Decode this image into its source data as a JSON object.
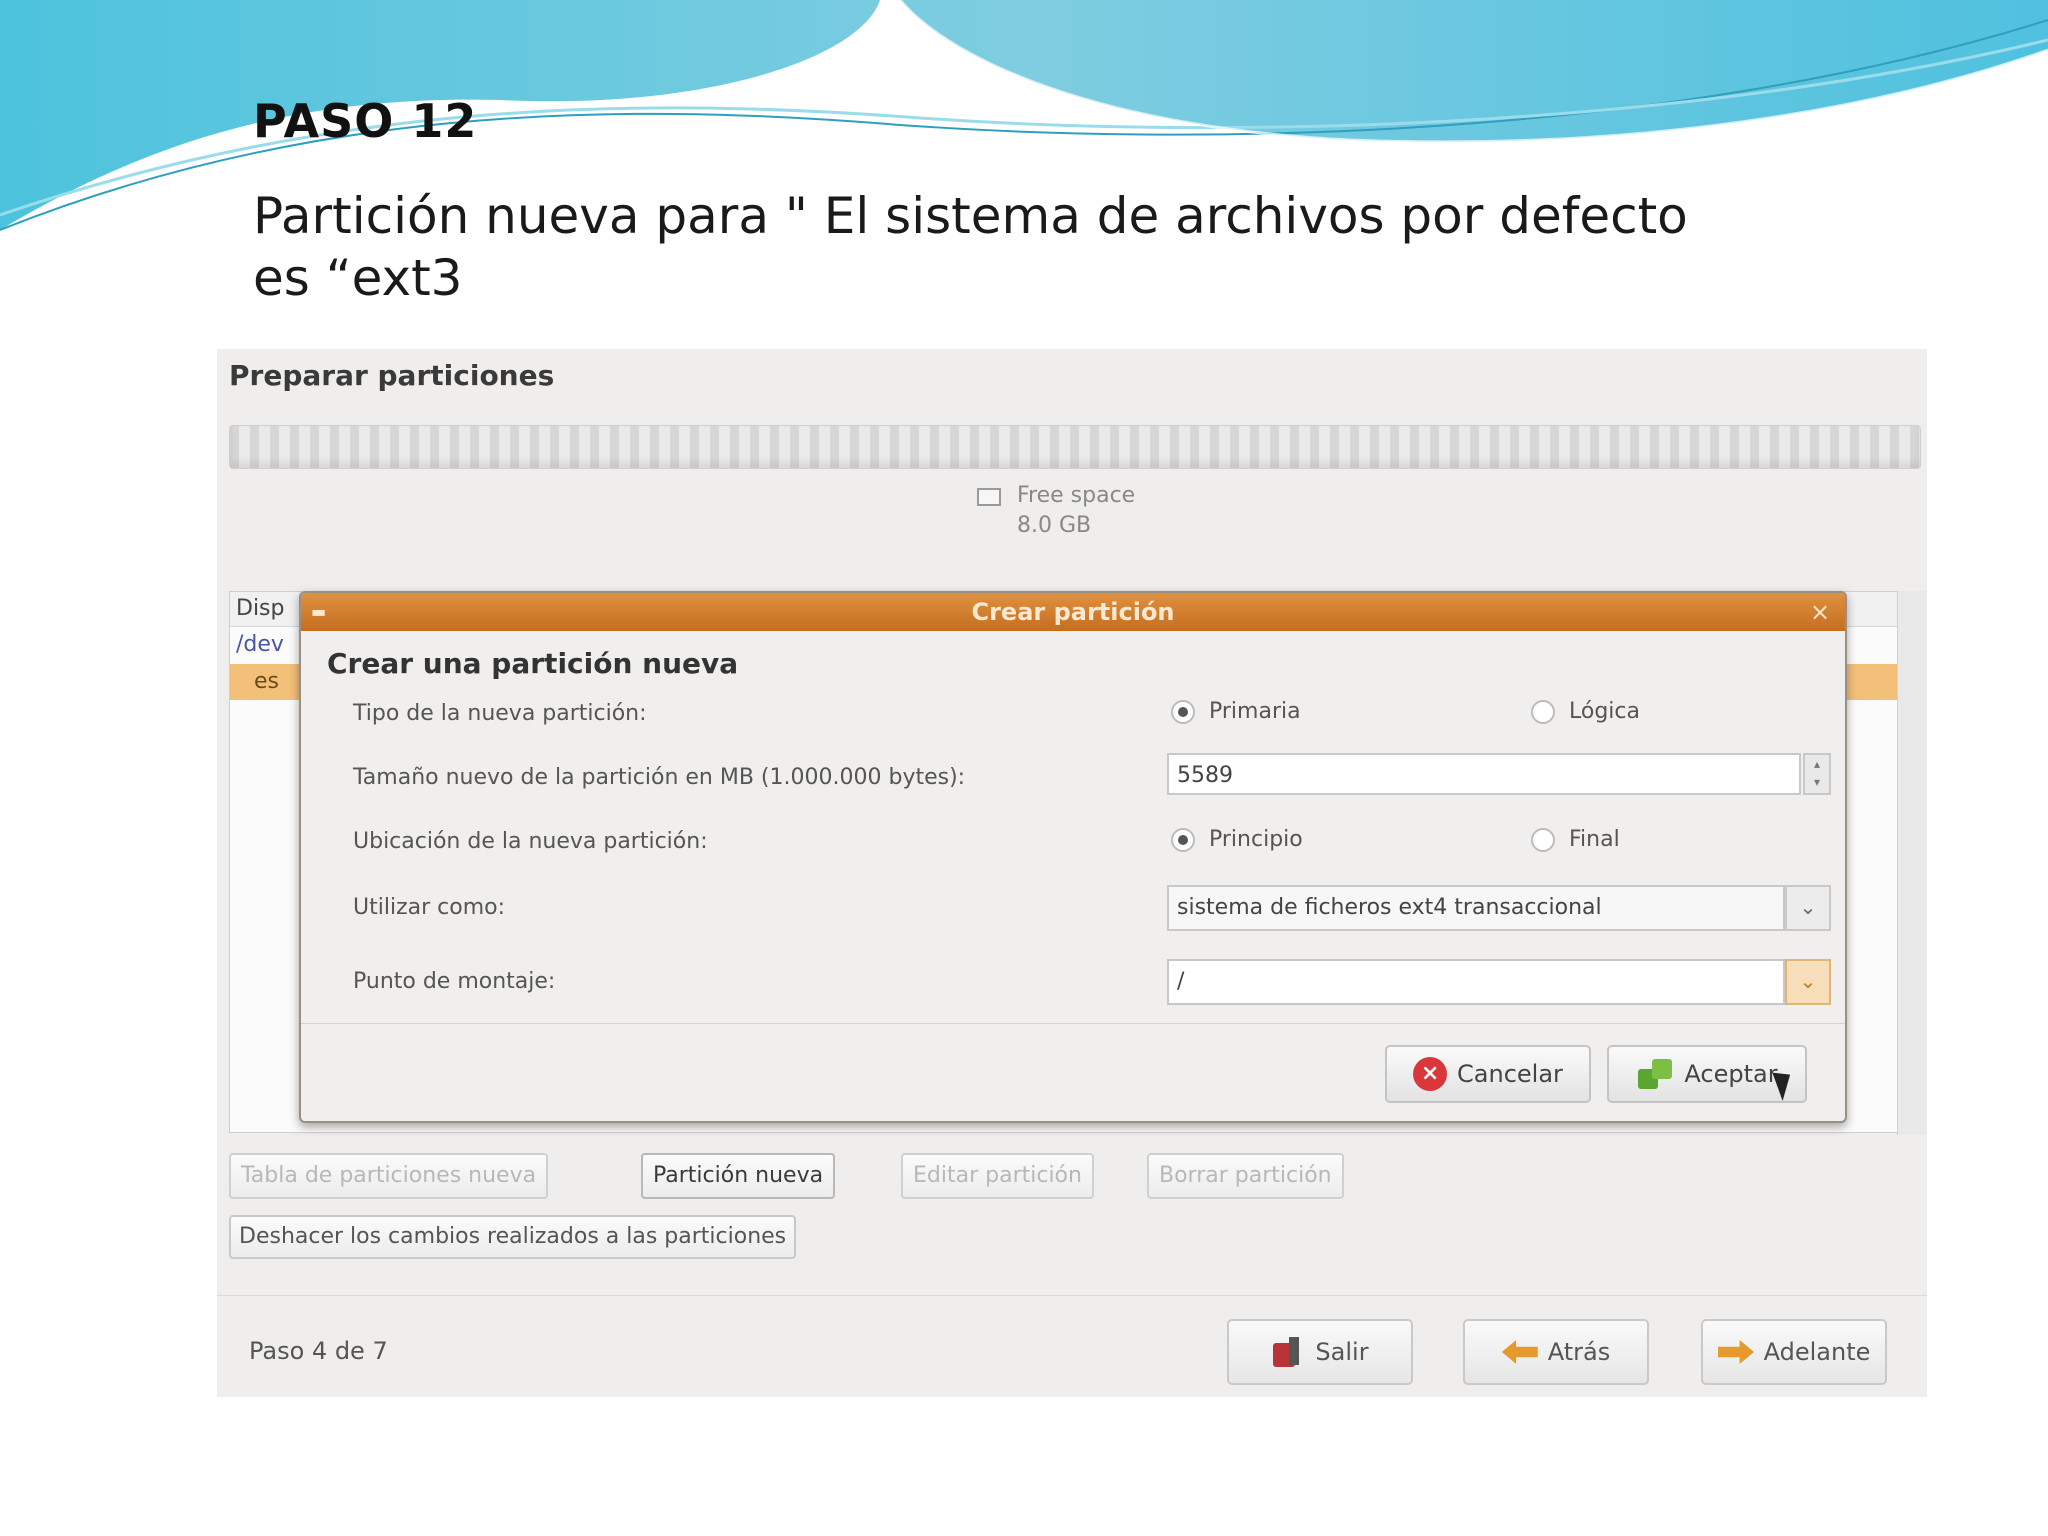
{
  "slide": {
    "title": "PASO 12",
    "body": "Partición nueva para \" El sistema de archivos por defecto es “ext3"
  },
  "installer": {
    "page_title": "Preparar particiones",
    "disk": {
      "legend_label": "Free space",
      "legend_size": "8.0 GB"
    },
    "tree": {
      "header": "Disp",
      "row1": "/dev",
      "row2": "es"
    },
    "dialog": {
      "window_title": "Crear partición",
      "heading": "Crear una partición nueva",
      "type_label": "Tipo de la nueva partición:",
      "type_options": [
        "Primaria",
        "Lógica"
      ],
      "type_selected": "Primaria",
      "size_label": "Tamaño nuevo de la partición en MB (1.000.000 bytes):",
      "size_value": "5589",
      "location_label": "Ubicación de la nueva partición:",
      "location_options": [
        "Principio",
        "Final"
      ],
      "location_selected": "Principio",
      "use_as_label": "Utilizar como:",
      "use_as_value": "sistema de ficheros ext4 transaccional",
      "mount_label": "Punto de montaje:",
      "mount_value": "/",
      "cancel_label": "Cancelar",
      "ok_label": "Aceptar"
    },
    "partition_buttons": [
      "Tabla de particiones nueva",
      "Partición nueva",
      "Editar partición",
      "Borrar partición"
    ],
    "undo_label": "Deshacer los cambios realizados a las particiones",
    "step_text": "Paso 4 de 7",
    "nav": {
      "quit": "Salir",
      "back": "Atrás",
      "forward": "Adelante"
    }
  },
  "colors": {
    "dialog_titlebar": "#d27a2c",
    "selection": "#f3c07a",
    "wave": "#5fc8e0"
  },
  "icons": {
    "cancel": "cancel-icon",
    "ok": "ok-icon",
    "quit": "quit-icon",
    "back": "back-arrow-icon",
    "forward": "forward-arrow-icon"
  }
}
